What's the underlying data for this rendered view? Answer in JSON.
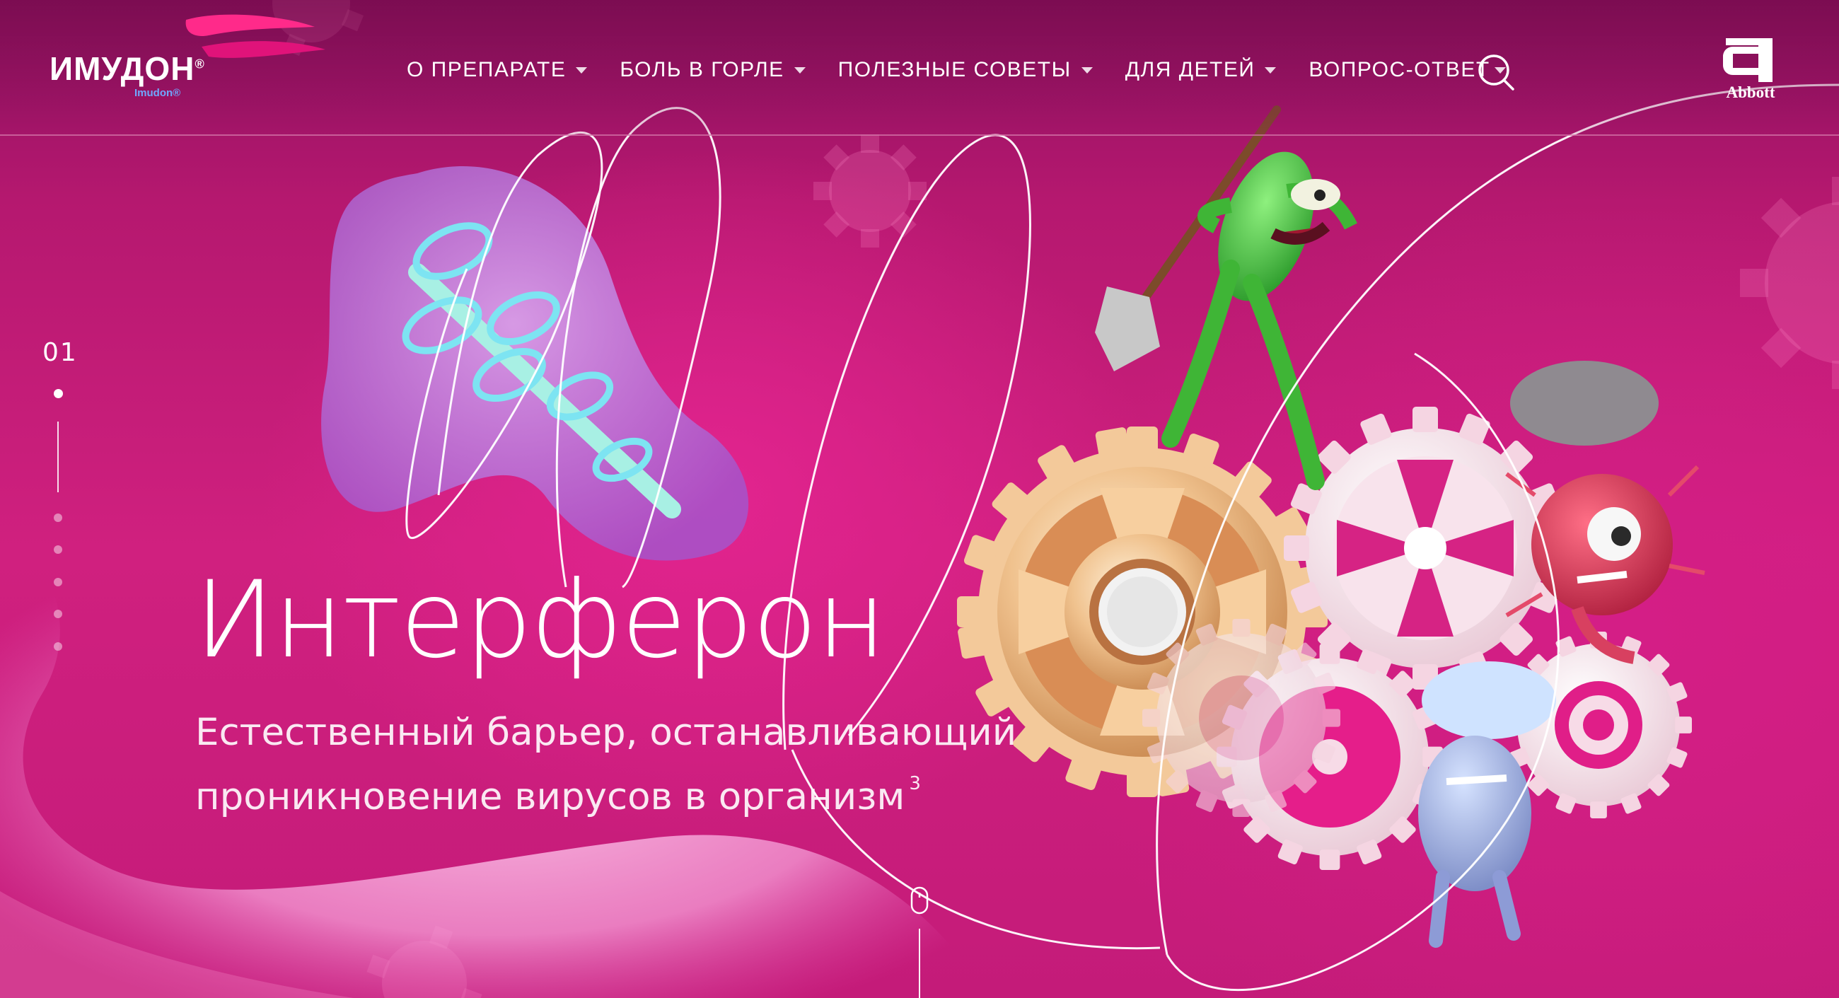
{
  "brand": {
    "logo_text": "ИМУДОН",
    "logo_registered": "®",
    "logo_subtext": "Imudon®",
    "partner_logo_text": "Abbott"
  },
  "nav": {
    "items": [
      {
        "label": "О ПРЕПАРАТЕ",
        "has_dropdown": true
      },
      {
        "label": "БОЛЬ В ГОРЛЕ",
        "has_dropdown": true
      },
      {
        "label": "ПОЛЕЗНЫЕ СОВЕТЫ",
        "has_dropdown": true
      },
      {
        "label": "ДЛЯ ДЕТЕЙ",
        "has_dropdown": true
      },
      {
        "label": "ВОПРОС-ОТВЕТ",
        "has_dropdown": true
      }
    ],
    "search_icon": "search-icon"
  },
  "slider": {
    "current_number": "01",
    "total_dots": 6,
    "active_index": 0
  },
  "hero": {
    "title": "Интерферон",
    "subtitle_line1": "Естественный барьер, останавливающий",
    "subtitle_line2": "проникновение вирусов в организм",
    "footnote": "3"
  },
  "icons": {
    "scroll": "mouse-scroll-icon"
  },
  "colors": {
    "background": "#c41b79",
    "header_dark": "#8d1060",
    "accent_pink": "#e2248f",
    "gold_gear": "#e9b985",
    "light_gear": "#f6dde6",
    "virus_green": "#3fbf3a"
  }
}
